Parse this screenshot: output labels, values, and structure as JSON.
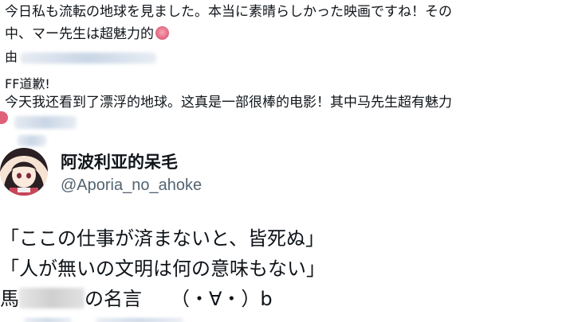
{
  "tweet": {
    "line1": "今日私も流転の地球を見ました。本当に素晴らしかった映画ですね！その",
    "line2": "中、マー先生は超魅力的",
    "line3_prefix": "由",
    "line4": "FF道歉!",
    "line5": "今天我还看到了漂浮的地球。这真是一部很棒的电影！其中马先生超有魅力"
  },
  "profile": {
    "display_name": "阿波利亚的呆毛",
    "handle": "@Aporia_no_ahoke"
  },
  "quotes": {
    "q1": "「ここの仕事が済まないと、皆死ぬ」",
    "q2": "「人が無いの文明は何の意味もない」",
    "q3_prefix": "馬",
    "q3_suffix": "の名言　　（・∀・）b"
  },
  "icons": {
    "emoji": "hot-face-emoji-icon",
    "avatar": "anime-girl-avatar"
  },
  "colors": {
    "text": "#0f1419",
    "secondary": "#536471",
    "divider": "#eff3f4"
  }
}
